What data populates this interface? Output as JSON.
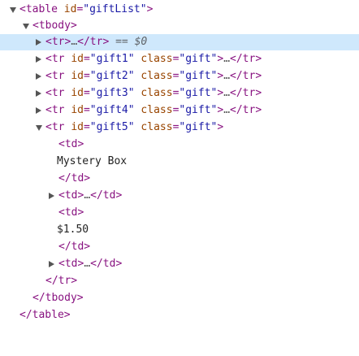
{
  "lines": [
    {
      "tag_open": "<table",
      "attr1": "id",
      "eq1": "=",
      "val1": "\"giftList\"",
      "close": ">"
    },
    {
      "tag_open": "<tbody>"
    },
    {
      "tag_open": "<tr>",
      "ellipsis": "…",
      "tag_close": "</tr>",
      "marker": " == $0"
    },
    {
      "tag_open": "<tr",
      "attr1": "id",
      "val1": "\"gift1\"",
      "attr2": "class",
      "val2": "\"gift\"",
      "close": ">",
      "ellipsis": "…",
      "tag_close": "</tr>"
    },
    {
      "tag_open": "<tr",
      "attr1": "id",
      "val1": "\"gift2\"",
      "attr2": "class",
      "val2": "\"gift\"",
      "close": ">",
      "ellipsis": "…",
      "tag_close": "</tr>"
    },
    {
      "tag_open": "<tr",
      "attr1": "id",
      "val1": "\"gift3\"",
      "attr2": "class",
      "val2": "\"gift\"",
      "close": ">",
      "ellipsis": "…",
      "tag_close": "</tr>"
    },
    {
      "tag_open": "<tr",
      "attr1": "id",
      "val1": "\"gift4\"",
      "attr2": "class",
      "val2": "\"gift\"",
      "close": ">",
      "ellipsis": "…",
      "tag_close": "</tr>"
    },
    {
      "tag_open": "<tr",
      "attr1": "id",
      "val1": "\"gift5\"",
      "attr2": "class",
      "val2": "\"gift\"",
      "close": ">"
    },
    {
      "tag_open": "<td>"
    },
    {
      "text": "Mystery Box"
    },
    {
      "tag_close": "</td>"
    },
    {
      "tag_open": "<td>",
      "ellipsis": "…",
      "tag_close": "</td>"
    },
    {
      "tag_open": "<td>"
    },
    {
      "text": "$1.50"
    },
    {
      "tag_close": "</td>"
    },
    {
      "tag_open": "<td>",
      "ellipsis": "…",
      "tag_close": "</td>"
    },
    {
      "tag_close": "</tr>"
    },
    {
      "tag_close": "</tbody>"
    },
    {
      "tag_close": "</table>"
    }
  ]
}
